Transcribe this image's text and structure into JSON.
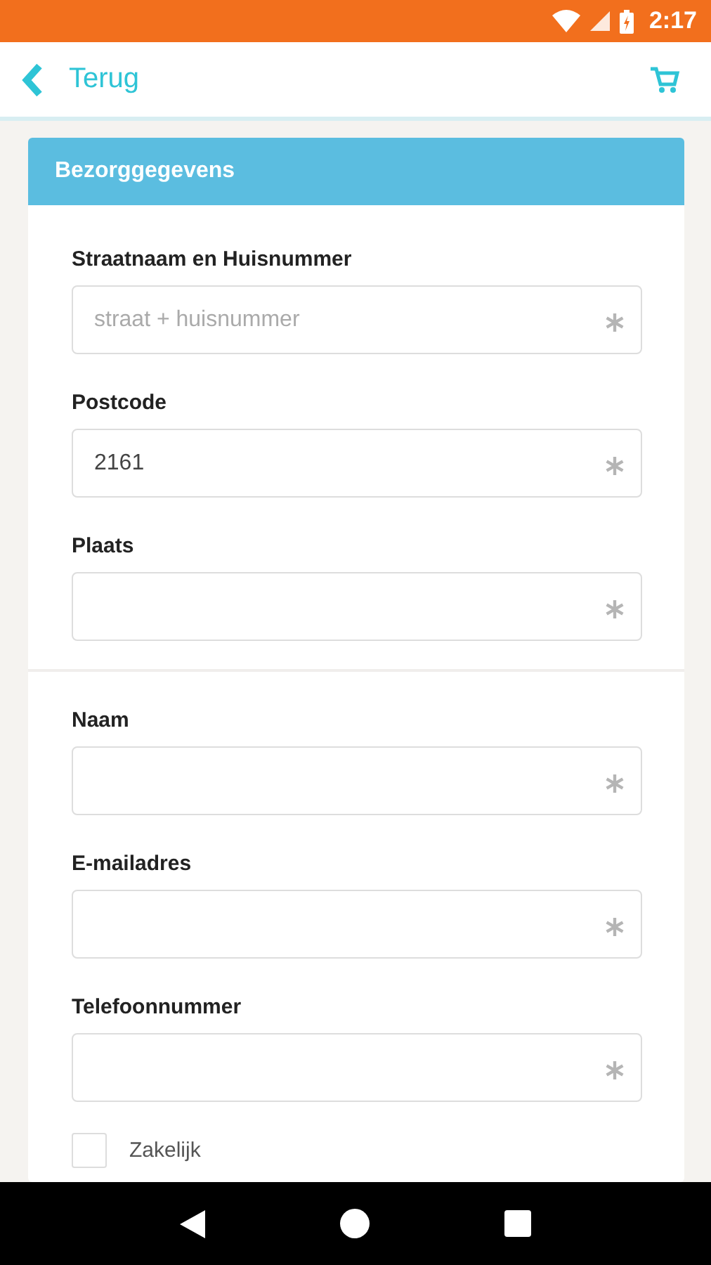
{
  "status_bar": {
    "time": "2:17"
  },
  "header": {
    "back_label": "Terug"
  },
  "card": {
    "title": "Bezorggegevens",
    "sections": [
      {
        "fields": [
          {
            "label": "Straatnaam en Huisnummer",
            "placeholder": "straat + huisnummer",
            "required": true
          },
          {
            "label": "Postcode",
            "value": "2161",
            "required": true
          },
          {
            "label": "Plaats",
            "required": true
          }
        ]
      },
      {
        "fields": [
          {
            "label": "Naam",
            "required": true
          },
          {
            "label": "E-mailadres",
            "required": true
          },
          {
            "label": "Telefoonnummer",
            "required": true
          }
        ]
      }
    ],
    "checkbox": {
      "label": "Zakelijk",
      "checked": false
    }
  }
}
